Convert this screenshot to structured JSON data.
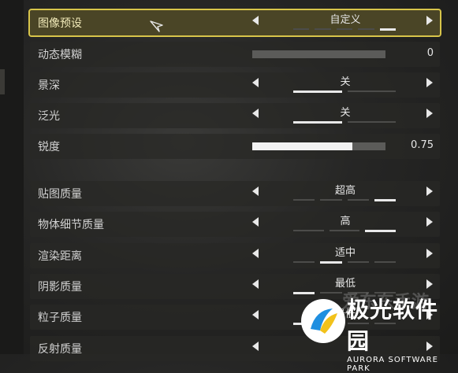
{
  "rows": [
    {
      "label": "图像预设",
      "kind": "selector",
      "value": "自定义",
      "segments": [
        false,
        false,
        false,
        false,
        true
      ],
      "selected": true
    },
    {
      "label": "动态模糊",
      "kind": "slider",
      "value": "0",
      "fill": 0.0
    },
    {
      "label": "景深",
      "kind": "selector",
      "value": "关",
      "segments": [
        true,
        false
      ]
    },
    {
      "label": "泛光",
      "kind": "selector",
      "value": "关",
      "segments": [
        true,
        false
      ]
    },
    {
      "label": "锐度",
      "kind": "slider",
      "value": "0.75",
      "fill": 0.75
    },
    {
      "label": "贴图质量",
      "kind": "selector",
      "value": "超高",
      "segments": [
        false,
        false,
        false,
        true
      ]
    },
    {
      "label": "物体细节质量",
      "kind": "selector",
      "value": "高",
      "segments": [
        false,
        false,
        true
      ]
    },
    {
      "label": "渲染距离",
      "kind": "selector",
      "value": "适中",
      "segments": [
        false,
        true,
        false,
        false
      ]
    },
    {
      "label": "阴影质量",
      "kind": "selector",
      "value": "最低",
      "segments": [
        true,
        false,
        false,
        false
      ]
    },
    {
      "label": "粒子质量",
      "kind": "selector",
      "value": "最低",
      "segments": [
        true,
        false,
        false,
        false
      ]
    },
    {
      "label": "反射质量",
      "kind": "selector",
      "value": "",
      "segments": []
    }
  ],
  "watermark": {
    "ghost": "爱东东手游",
    "main": "极光软件园",
    "sub": "AURORA SOFTWARE PARK"
  },
  "colors": {
    "accent": "#d8c54a",
    "selected_bg": "#4a4526",
    "segment_on": "#e9e9e9",
    "segment_off": "#4c4c4a"
  }
}
